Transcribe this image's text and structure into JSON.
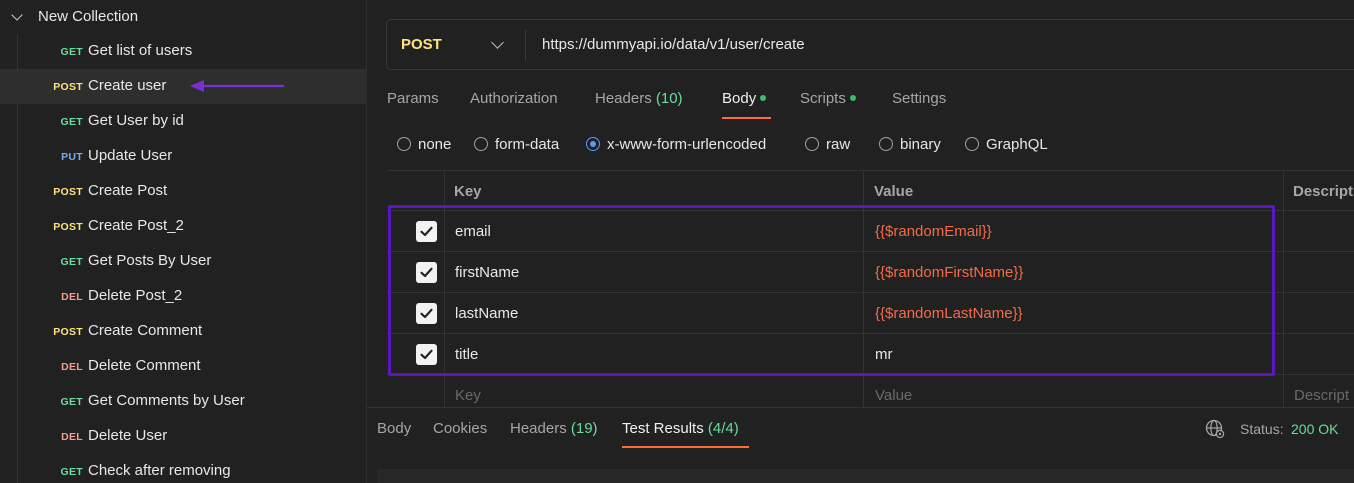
{
  "sidebar": {
    "collection_title": "New Collection",
    "requests": [
      {
        "method": "GET",
        "name": "Get list of users"
      },
      {
        "method": "POST",
        "name": "Create user"
      },
      {
        "method": "GET",
        "name": "Get User by id"
      },
      {
        "method": "PUT",
        "name": "Update User"
      },
      {
        "method": "POST",
        "name": "Create Post"
      },
      {
        "method": "POST",
        "name": "Create Post_2"
      },
      {
        "method": "GET",
        "name": "Get Posts By User"
      },
      {
        "method": "DEL",
        "name": "Delete Post_2"
      },
      {
        "method": "POST",
        "name": "Create Comment"
      },
      {
        "method": "DEL",
        "name": "Delete Comment"
      },
      {
        "method": "GET",
        "name": "Get Comments by User"
      },
      {
        "method": "DEL",
        "name": "Delete User"
      },
      {
        "method": "GET",
        "name": "Check after removing"
      }
    ]
  },
  "request": {
    "method": "POST",
    "url": "https://dummyapi.io/data/v1/user/create",
    "tabs": {
      "params": "Params",
      "authorization": "Authorization",
      "headers": "Headers",
      "headers_count": "(10)",
      "body": "Body",
      "scripts": "Scripts",
      "settings": "Settings"
    },
    "body_types": {
      "none": "none",
      "form_data": "form-data",
      "urlencoded": "x-www-form-urlencoded",
      "raw": "raw",
      "binary": "binary",
      "graphql": "GraphQL"
    },
    "table": {
      "key_header": "Key",
      "value_header": "Value",
      "description_header": "Descript",
      "rows": [
        {
          "key": "email",
          "value": "{{$randomEmail}}"
        },
        {
          "key": "firstName",
          "value": "{{$randomFirstName}}"
        },
        {
          "key": "lastName",
          "value": "{{$randomLastName}}"
        },
        {
          "key": "title",
          "value": "mr"
        }
      ],
      "placeholder_key": "Key",
      "placeholder_value": "Value",
      "placeholder_description": "Descript"
    }
  },
  "response": {
    "tabs": {
      "body": "Body",
      "cookies": "Cookies",
      "headers": "Headers",
      "headers_count": "(19)",
      "test_results": "Test Results",
      "test_results_count": "(4/4)"
    },
    "status_label": "Status:",
    "status_value": "200 OK"
  },
  "colors": {
    "accent": "#ff6c37",
    "highlight": "#5a17b9",
    "get": "#6bdd9a",
    "post": "#ffe47e",
    "put": "#74aef6",
    "del": "#f79a8e"
  }
}
